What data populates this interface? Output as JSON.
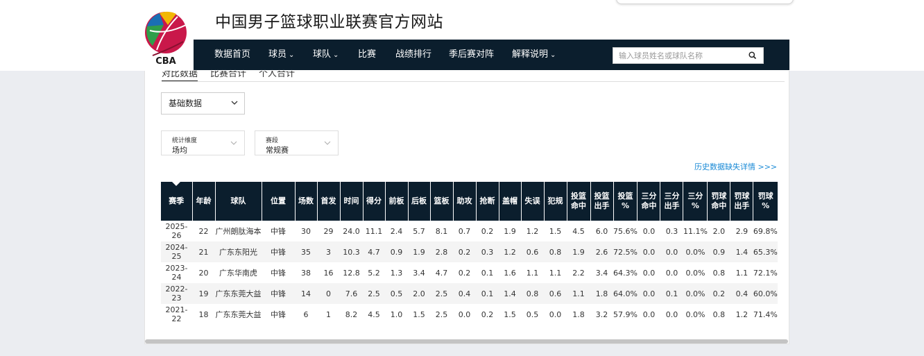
{
  "site": {
    "title": "中国男子篮球职业联赛官方网站",
    "logo_text": "CBA"
  },
  "nav": {
    "items": [
      {
        "label": "数据首页",
        "dropdown": false
      },
      {
        "label": "球员",
        "dropdown": true
      },
      {
        "label": "球队",
        "dropdown": true
      },
      {
        "label": "比赛",
        "dropdown": false
      },
      {
        "label": "战绩排行",
        "dropdown": false
      },
      {
        "label": "季后赛对阵",
        "dropdown": false
      },
      {
        "label": "解释说明",
        "dropdown": true
      }
    ],
    "search_placeholder": "输入球员姓名或球队名称"
  },
  "tabs": [
    "对比数据",
    "比赛合计",
    "个人合计"
  ],
  "data_type_select": "基础数据",
  "filters": [
    {
      "label": "统计维度",
      "value": "场均"
    },
    {
      "label": "赛段",
      "value": "常规赛"
    }
  ],
  "history_link": "历史数据缺失详情 >>>",
  "table": {
    "headers": [
      "赛季",
      "年龄",
      "球队",
      "位置",
      "场数",
      "首发",
      "时间",
      "得分",
      "前板",
      "后板",
      "篮板",
      "助攻",
      "抢断",
      "盖帽",
      "失误",
      "犯规",
      "投篮\n命中",
      "投篮\n出手",
      "投篮\n%",
      "三分\n命中",
      "三分\n出手",
      "三分\n%",
      "罚球\n命中",
      "罚球\n出手",
      "罚球\n%"
    ],
    "rows": [
      [
        "2025-26",
        "22",
        "广州朗肽海本",
        "中锋",
        "30",
        "29",
        "24.0",
        "11.1",
        "2.4",
        "5.7",
        "8.1",
        "0.7",
        "0.2",
        "1.9",
        "1.2",
        "1.5",
        "4.5",
        "6.0",
        "75.6%",
        "0.0",
        "0.3",
        "11.1%",
        "2.0",
        "2.9",
        "69.8%"
      ],
      [
        "2024-25",
        "21",
        "广东东阳光",
        "中锋",
        "35",
        "3",
        "10.3",
        "4.7",
        "0.9",
        "1.9",
        "2.8",
        "0.2",
        "0.3",
        "1.2",
        "0.6",
        "0.8",
        "1.9",
        "2.6",
        "72.5%",
        "0.0",
        "0.0",
        "0.0%",
        "0.9",
        "1.4",
        "65.3%"
      ],
      [
        "2023-24",
        "20",
        "广东华南虎",
        "中锋",
        "38",
        "16",
        "12.8",
        "5.2",
        "1.3",
        "3.4",
        "4.7",
        "0.2",
        "0.1",
        "1.6",
        "1.1",
        "1.1",
        "2.2",
        "3.4",
        "64.3%",
        "0.0",
        "0.0",
        "0.0%",
        "0.8",
        "1.1",
        "72.1%"
      ],
      [
        "2022-23",
        "19",
        "广东东莞大益",
        "中锋",
        "14",
        "0",
        "7.6",
        "2.5",
        "0.5",
        "2.0",
        "2.5",
        "0.4",
        "0.1",
        "1.4",
        "0.8",
        "0.6",
        "1.1",
        "1.8",
        "64.0%",
        "0.0",
        "0.1",
        "0.0%",
        "0.2",
        "0.4",
        "60.0%"
      ],
      [
        "2021-22",
        "18",
        "广东东莞大益",
        "中锋",
        "6",
        "1",
        "8.2",
        "4.5",
        "1.0",
        "1.5",
        "2.5",
        "0.0",
        "0.2",
        "1.5",
        "0.5",
        "0.0",
        "1.8",
        "3.2",
        "57.9%",
        "0.0",
        "0.0",
        "0.0%",
        "0.8",
        "1.2",
        "71.4%"
      ]
    ]
  },
  "colors": {
    "nav_bg": "#0b1e2d",
    "link": "#1a8ad6",
    "page_bg": "#ebedf1"
  }
}
